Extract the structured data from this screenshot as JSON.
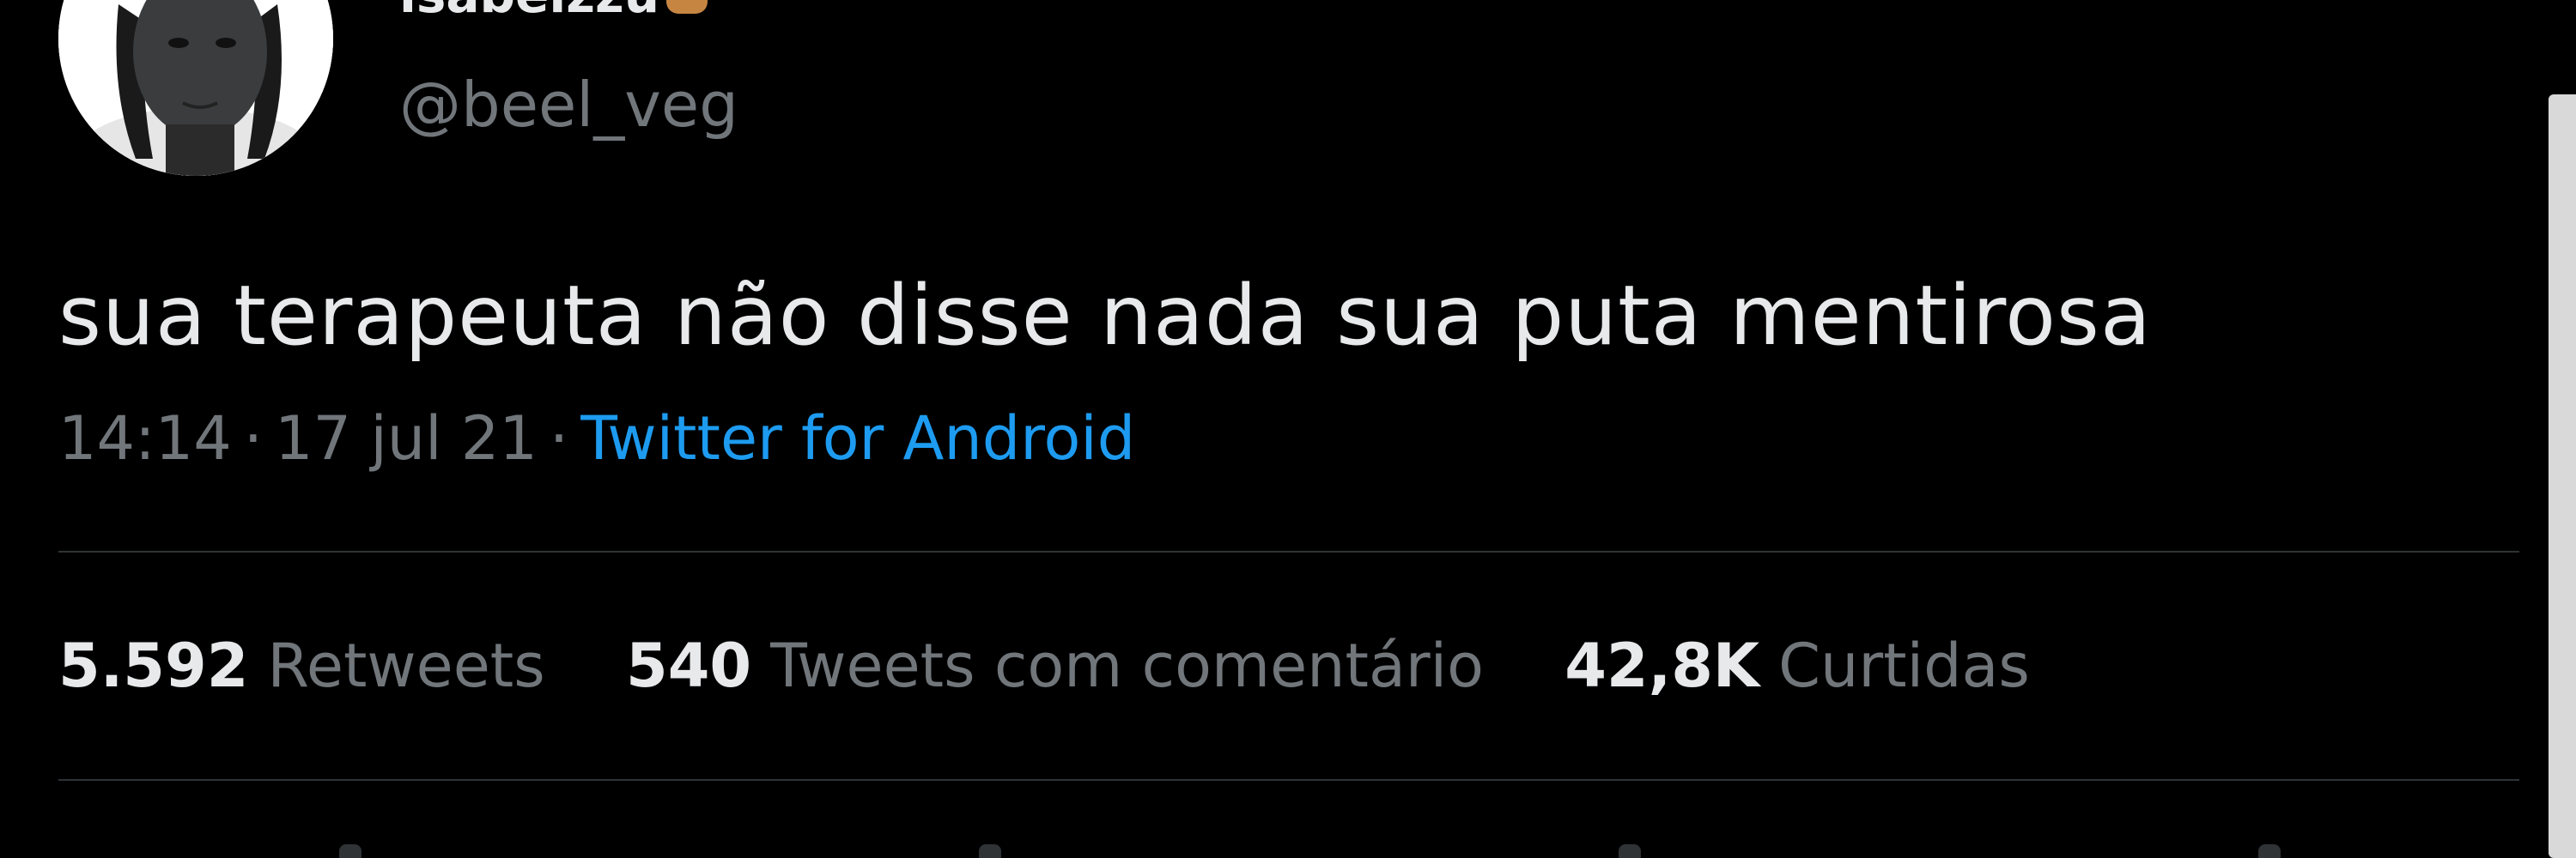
{
  "tweet": {
    "author": {
      "display_name": "isabelzzu",
      "emoji_icon": "flexed-biceps-emoji",
      "handle": "@beel_veg",
      "avatar_icon": "profile-photo"
    },
    "text": "sua terapeuta não disse nada sua puta mentirosa",
    "time": "14:14",
    "date": "17 jul 21",
    "separator": "·",
    "source": "Twitter for Android",
    "stats": [
      {
        "value": "5.592",
        "label": "Retweets"
      },
      {
        "value": "540",
        "label": "Tweets com comentário"
      },
      {
        "value": "42,8K",
        "label": "Curtidas"
      }
    ]
  },
  "colors": {
    "background": "#000000",
    "primary_text": "#e7e9ea",
    "secondary_text": "#71767b",
    "link": "#1d9bf0",
    "divider": "#2f3336"
  }
}
